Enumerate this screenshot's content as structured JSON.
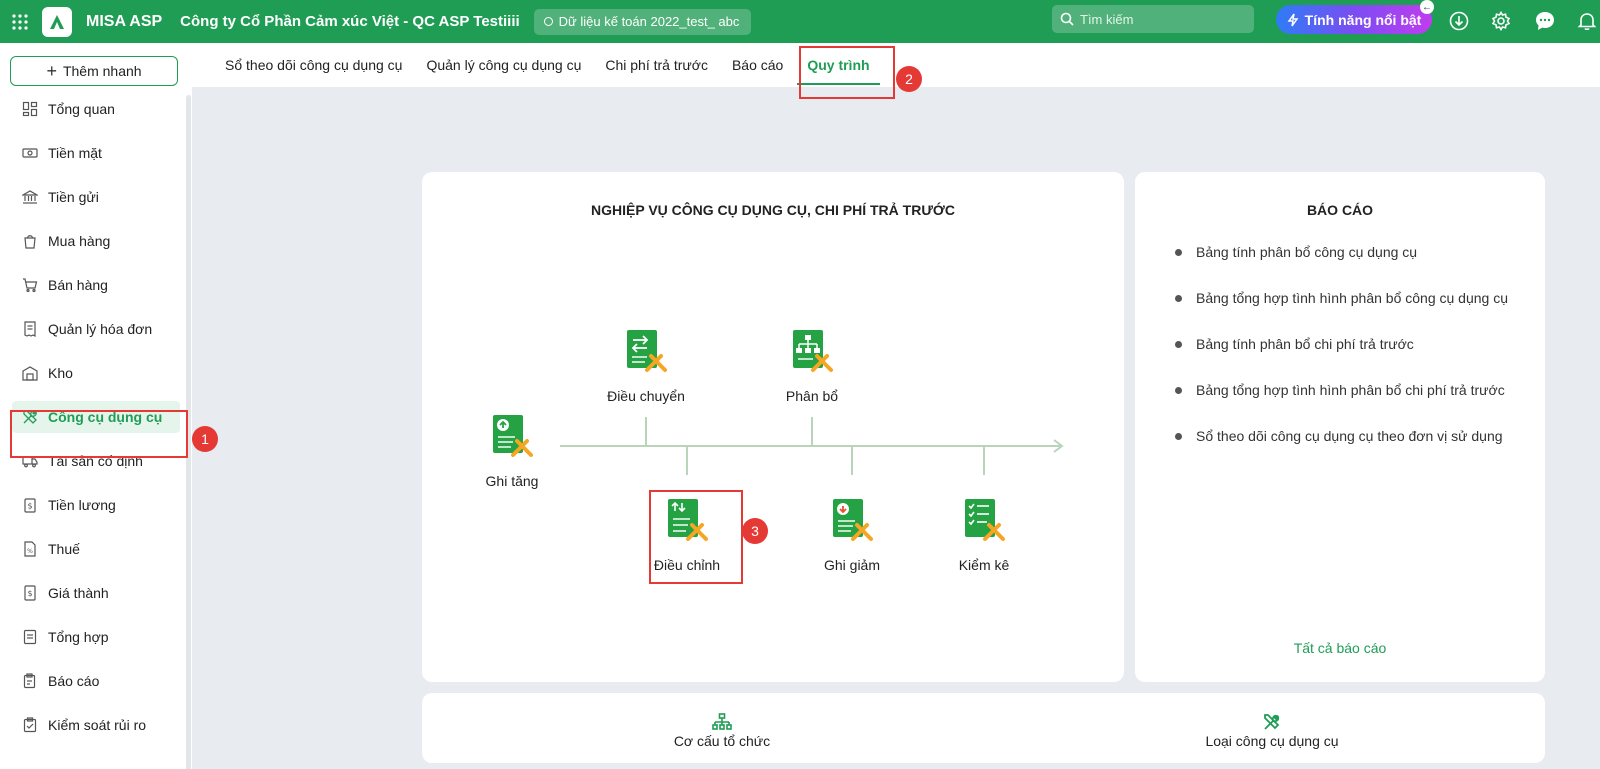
{
  "header": {
    "brand": "MISA ASP",
    "company": "Công ty Cổ Phần Cảm xúc Việt - QC ASP Testiiii",
    "dataset": "Dữ liệu kế toán 2022_test_ abc",
    "search_placeholder": "Tìm kiếm",
    "feature_button": "Tính năng nổi bật"
  },
  "sidebar": {
    "quick_add": "Thêm nhanh",
    "items": [
      {
        "label": "Tổng quan",
        "icon": "dashboard-icon"
      },
      {
        "label": "Tiền mặt",
        "icon": "cash-icon"
      },
      {
        "label": "Tiền gửi",
        "icon": "bank-icon"
      },
      {
        "label": "Mua hàng",
        "icon": "shopping-bag-icon"
      },
      {
        "label": "Bán hàng",
        "icon": "cart-icon"
      },
      {
        "label": "Quản lý hóa đơn",
        "icon": "invoice-icon"
      },
      {
        "label": "Kho",
        "icon": "warehouse-icon"
      },
      {
        "label": "Công cụ dụng cụ",
        "icon": "tools-icon"
      },
      {
        "label": "Tài sản cố định",
        "icon": "truck-icon"
      },
      {
        "label": "Tiền lương",
        "icon": "salary-icon"
      },
      {
        "label": "Thuế",
        "icon": "tax-icon"
      },
      {
        "label": "Giá thành",
        "icon": "price-icon"
      },
      {
        "label": "Tổng hợp",
        "icon": "summary-icon"
      },
      {
        "label": "Báo cáo",
        "icon": "report-icon"
      },
      {
        "label": "Kiểm soát rủi ro",
        "icon": "risk-control-icon"
      }
    ]
  },
  "tabs": [
    {
      "label": "Sổ theo dõi công cụ dụng cụ"
    },
    {
      "label": "Quản lý công cụ dụng cụ"
    },
    {
      "label": "Chi phí trả trước"
    },
    {
      "label": "Báo cáo"
    },
    {
      "label": "Quy trình"
    }
  ],
  "process": {
    "title": "NGHIỆP VỤ CÔNG CỤ DỤNG CỤ, CHI PHÍ TRẢ TRƯỚC",
    "nodes": {
      "ghi_tang": "Ghi tăng",
      "dieu_chuyen": "Điều chuyển",
      "phan_bo": "Phân bổ",
      "dieu_chinh": "Điều chỉnh",
      "ghi_giam": "Ghi giảm",
      "kiem_ke": "Kiểm kê"
    }
  },
  "reports": {
    "title": "BÁO CÁO",
    "items": [
      "Bảng tính phân bổ công cụ dụng cụ",
      "Bảng tổng hợp tình hình phân bổ công cụ dụng cụ",
      "Bảng tính phân bổ chi phí trả trước",
      "Bảng tổng hợp tình hình phân bổ chi phí trả trước",
      "Sổ theo dõi công cụ dụng cụ theo đơn vị sử dụng"
    ],
    "all_link": "Tất cả báo cáo"
  },
  "bottom_links": {
    "org": "Cơ cấu tổ chức",
    "tool_type": "Loại công cụ dụng cụ"
  },
  "annotations": {
    "badge1": "1",
    "badge2": "2",
    "badge3": "3"
  },
  "colors": {
    "brand_green": "#1f9d55",
    "highlight_red": "#e53935"
  }
}
